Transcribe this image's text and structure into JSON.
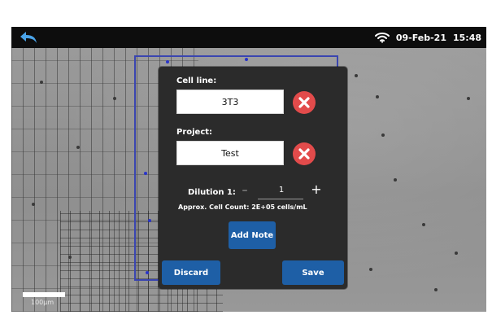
{
  "status": {
    "date": "09-Feb-21",
    "time": "15:48"
  },
  "dialog": {
    "cell_line_label": "Cell line:",
    "cell_line_value": "3T3",
    "project_label": "Project:",
    "project_value": "Test",
    "dilution_label": "Dilution 1:",
    "dilution_value": "1",
    "approx_count": "Approx. Cell Count: 2E+05 cells/mL",
    "add_note_label": "Add Note",
    "discard_label": "Discard",
    "save_label": "Save"
  },
  "microscope": {
    "scale_label": "100µm"
  },
  "colors": {
    "accent": "#1e5fa6",
    "clear": "#e24b4b",
    "roi": "#3a45b0"
  },
  "icons": {
    "back": "back-arrow-icon",
    "wifi": "wifi-icon",
    "clear": "clear-x-icon"
  }
}
